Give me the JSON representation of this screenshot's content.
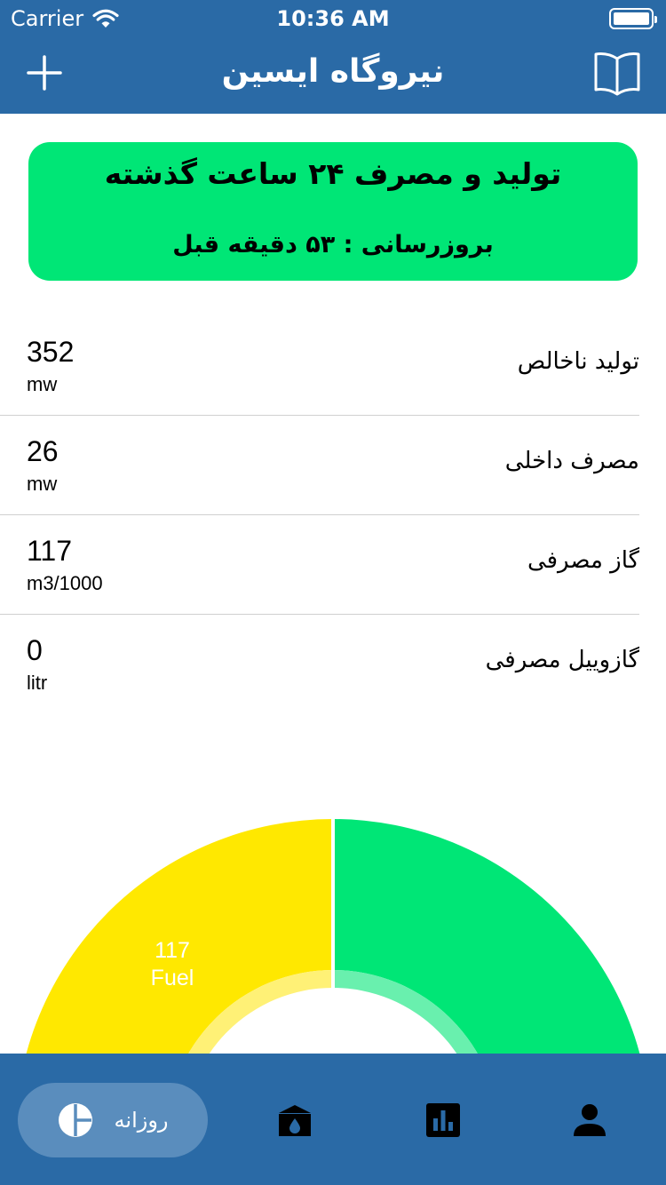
{
  "status_bar": {
    "carrier": "Carrier",
    "time": "10:36 AM"
  },
  "nav": {
    "title": "نیروگاه ایسین",
    "left_icon": "plus-icon",
    "right_icon": "book-icon"
  },
  "banner": {
    "title": "تولید و مصرف ۲۴ ساعت گذشته",
    "update": "بروزرسانی : ۵۳ دقیقه قبل",
    "color": "#00e676"
  },
  "stats": [
    {
      "label": "تولید ناخالص",
      "value": "352",
      "unit": "mw"
    },
    {
      "label": "مصرف داخلی",
      "value": "26",
      "unit": "mw"
    },
    {
      "label": "گاز مصرفی",
      "value": "117",
      "unit": "m3/1000"
    },
    {
      "label": "گازوییل مصرفی",
      "value": "0",
      "unit": "litr"
    }
  ],
  "gauge": {
    "segments": [
      {
        "value": "117",
        "label": "Fuel",
        "fraction": 0.5,
        "color": "#ffe800",
        "inner_color": "#fff176"
      },
      {
        "fraction": 0.5,
        "color": "#00e676",
        "inner_color": "#69f0ae"
      }
    ]
  },
  "tab_bar": {
    "active_label": "روزانه",
    "tabs": [
      "daily-icon",
      "plant-icon",
      "chart-icon",
      "profile-icon"
    ]
  },
  "colors": {
    "primary": "#2a6aa6",
    "active_tab": "#5a8dbd",
    "green": "#00e676",
    "yellow": "#ffe800"
  }
}
